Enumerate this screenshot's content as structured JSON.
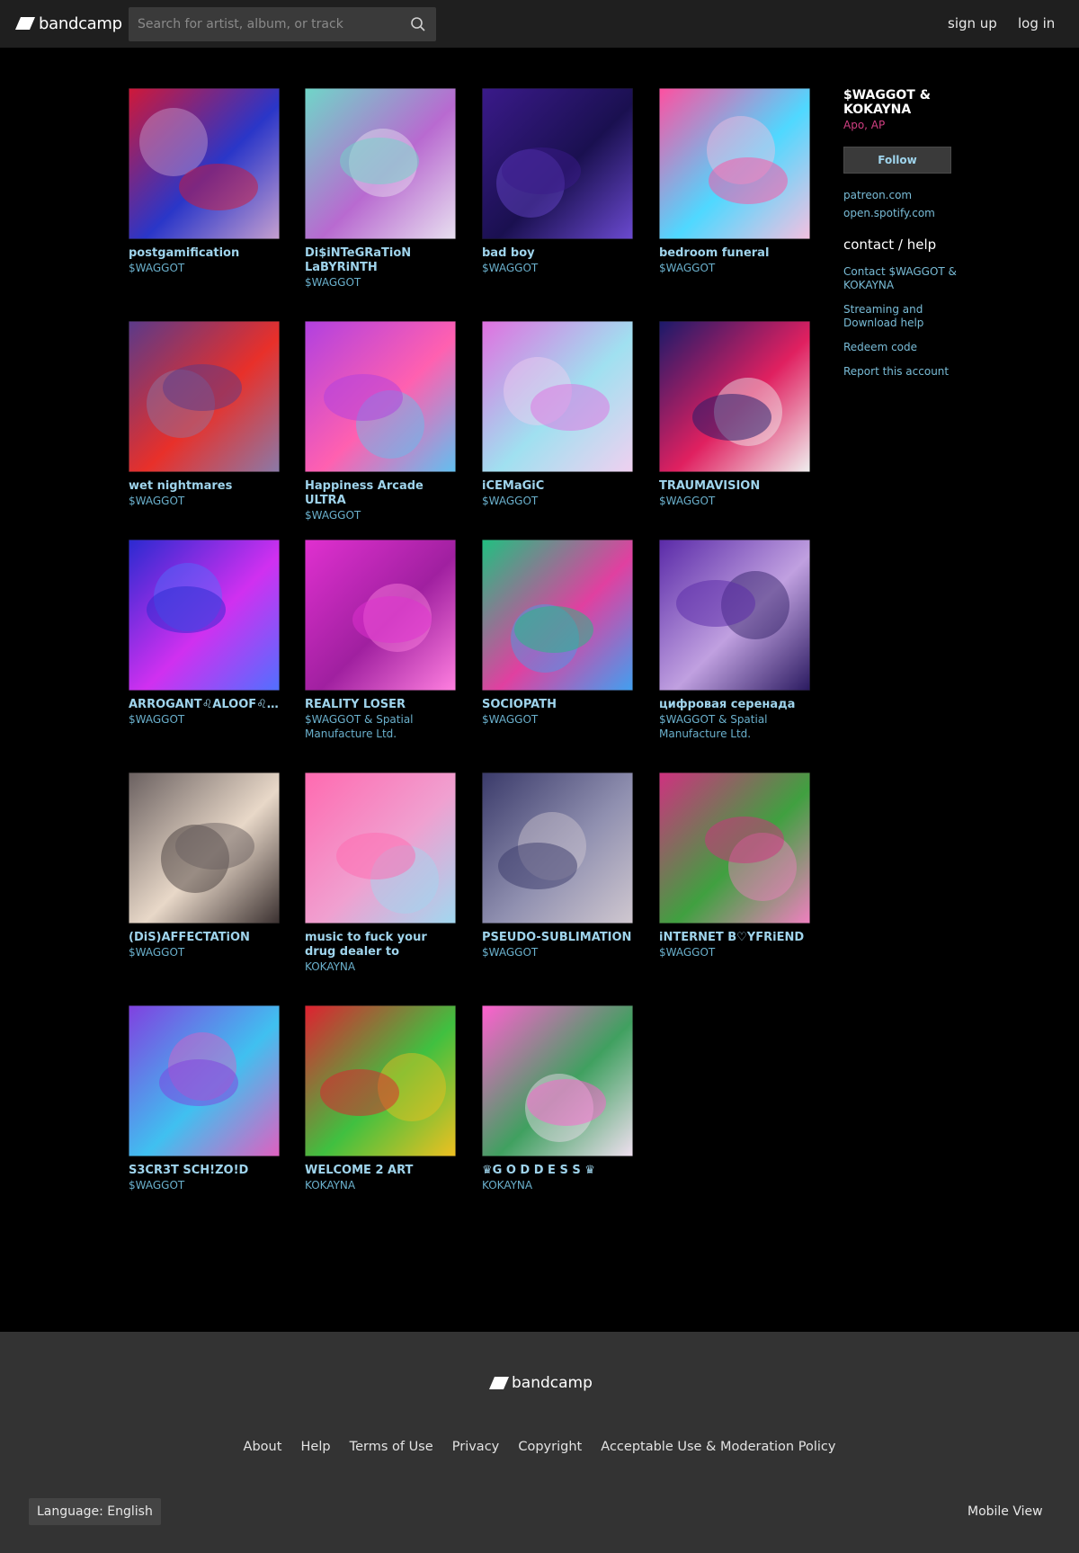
{
  "header": {
    "logo_text": "bandcamp",
    "search_placeholder": "Search for artist, album, or track",
    "signup": "sign up",
    "login": "log in"
  },
  "albums": [
    {
      "title": "postgamification",
      "artist": "$WAGGOT",
      "colors": [
        "#d01838",
        "#2a36c8",
        "#c6a0d0"
      ]
    },
    {
      "title": "Di$iNTeGRaTioN LaBYRiNTH",
      "artist": "$WAGGOT",
      "colors": [
        "#6fd6c8",
        "#b86ad0",
        "#e8e0f0"
      ]
    },
    {
      "title": "bad boy",
      "artist": "$WAGGOT",
      "colors": [
        "#3a1a8a",
        "#1a1050",
        "#6b4ad0"
      ]
    },
    {
      "title": "bedroom funeral",
      "artist": "$WAGGOT",
      "colors": [
        "#ff4fa0",
        "#4fd8ff",
        "#f4c0e0"
      ]
    },
    {
      "title": "wet nightmares",
      "artist": "$WAGGOT",
      "colors": [
        "#5a3a8a",
        "#e8302a",
        "#8a7aa8"
      ]
    },
    {
      "title": "Happiness Arcade ULTRA",
      "artist": "$WAGGOT",
      "colors": [
        "#b040e0",
        "#ff60b0",
        "#60c0f0"
      ]
    },
    {
      "title": "iCEMaGiC",
      "artist": "$WAGGOT",
      "colors": [
        "#e070e0",
        "#a0e0f0",
        "#f0d0f0"
      ]
    },
    {
      "title": "TRAUMAVISION",
      "artist": "$WAGGOT",
      "colors": [
        "#1a1a6a",
        "#e02060",
        "#f0f0f0"
      ]
    },
    {
      "title": "ARROGANT♌ALOOF♌AAA",
      "artist": "$WAGGOT",
      "colors": [
        "#2a2ad0",
        "#d030f0",
        "#5070ff"
      ]
    },
    {
      "title": "REALITY LOSER",
      "artist": "$WAGGOT & Spatial Manufacture Ltd.",
      "colors": [
        "#e030d0",
        "#a020a0",
        "#ff80e0"
      ]
    },
    {
      "title": "SOCIOPATH",
      "artist": "$WAGGOT",
      "colors": [
        "#20c080",
        "#e040a0",
        "#40a0f0"
      ]
    },
    {
      "title": "цифровая серенада",
      "artist": "$WAGGOT & Spatial Manufacture Ltd.",
      "colors": [
        "#5a2aa8",
        "#c0a0e0",
        "#2a1a60"
      ]
    },
    {
      "title": "(DiS)AFFECTATiON",
      "artist": "$WAGGOT",
      "colors": [
        "#6a6060",
        "#e8d8c8",
        "#3a3030"
      ]
    },
    {
      "title": "music to fuck your drug dealer to",
      "artist": "KOKAYNA",
      "colors": [
        "#ff6ab0",
        "#f0a0d0",
        "#a0d8f0"
      ]
    },
    {
      "title": "PSEUDO-SUBLIMATION",
      "artist": "$WAGGOT",
      "colors": [
        "#3a3a6a",
        "#9090b0",
        "#d0c8d0"
      ]
    },
    {
      "title": "iNTERNET B♡YFRiEND",
      "artist": "$WAGGOT",
      "colors": [
        "#d03080",
        "#40a040",
        "#f080c0"
      ]
    },
    {
      "title": "S3CR3T SCH!ZO!D",
      "artist": "$WAGGOT",
      "colors": [
        "#8040e0",
        "#40c0f0",
        "#e060c0"
      ]
    },
    {
      "title": "WELCOME 2 ART",
      "artist": "KOKAYNA",
      "colors": [
        "#e02030",
        "#40c040",
        "#f0c020"
      ]
    },
    {
      "title": "♛G O D D E S S ♛",
      "artist": "KOKAYNA",
      "colors": [
        "#ff60d0",
        "#40a060",
        "#f0e0f0"
      ]
    }
  ],
  "sidebar": {
    "band_name": "$WAGGOT & KOKAYNA",
    "location": "Apo, AP",
    "follow": "Follow",
    "links": [
      "patreon.com",
      "open.spotify.com"
    ],
    "help_heading": "contact / help",
    "help_links": [
      "Contact $WAGGOT & KOKAYNA",
      "Streaming and Download help",
      "Redeem code",
      "Report this account"
    ]
  },
  "footer": {
    "logo_text": "bandcamp",
    "links": [
      "About",
      "Help",
      "Terms of Use",
      "Privacy",
      "Copyright",
      "Acceptable Use & Moderation Policy"
    ],
    "language_label": "Language:",
    "language_value": "English",
    "mobile_view": "Mobile View"
  }
}
